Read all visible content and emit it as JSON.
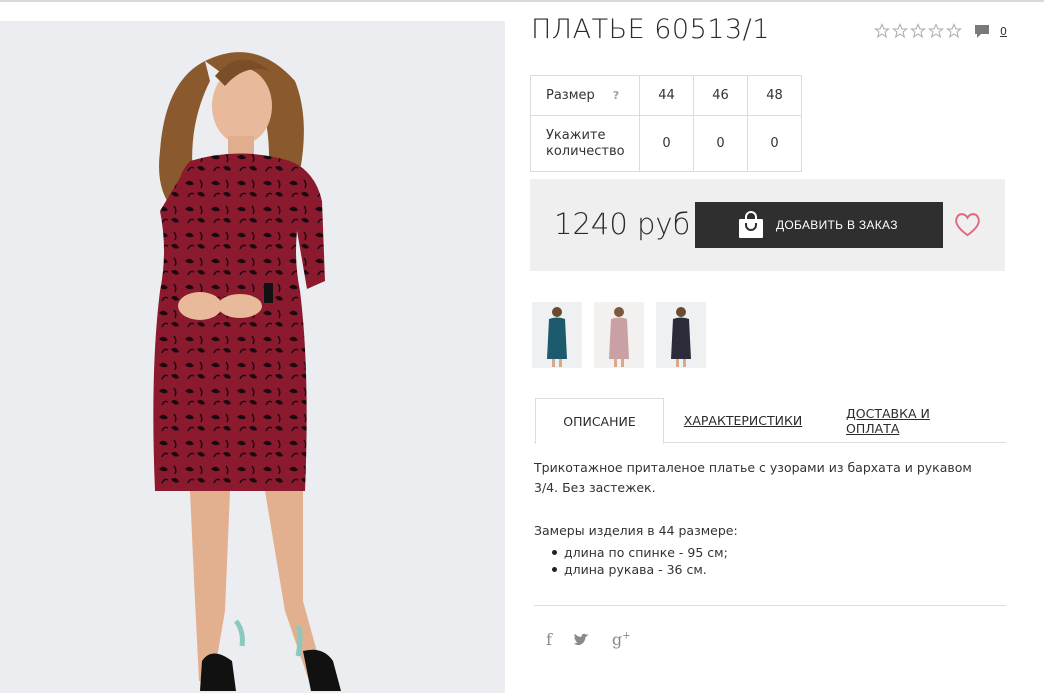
{
  "product": {
    "title": "ПЛАТЬЕ 60513/1",
    "rating_stars": 0,
    "rating_max": 5,
    "comments_count": "0",
    "price": "1240 руб",
    "order_label": "ДОБАВИТЬ В ЗАКАЗ"
  },
  "size_table": {
    "size_label": "Размер",
    "help_mark": "?",
    "qty_label_line1": "Укажите",
    "qty_label_line2": "количество",
    "sizes": [
      "44",
      "46",
      "48"
    ],
    "quantities": [
      "0",
      "0",
      "0"
    ]
  },
  "tabs": [
    {
      "label": "ОПИСАНИЕ",
      "active": true
    },
    {
      "label": "ХАРАКТЕРИСТИКИ",
      "active": false
    },
    {
      "label": "ДОСТАВКА И ОПЛАТА",
      "active": false
    }
  ],
  "description": {
    "text": "Трикотажное приталеное платье с узорами из бархата и рукавом 3/4. Без застежек.",
    "measure_title": "Замеры изделия в 44 размере:",
    "measures": [
      "длина по спинке - 95 см;",
      "длина рукава - 36 см."
    ]
  },
  "thumbnails": [
    {
      "name": "thumb-teal-dress",
      "color": "#1d5a6e"
    },
    {
      "name": "thumb-pink-dress",
      "color": "#c9a1a4"
    },
    {
      "name": "thumb-navy-dress",
      "color": "#2a2c3a"
    }
  ],
  "social": {
    "facebook": "f",
    "twitter": "t",
    "gplus": "g",
    "gplus_sup": "+"
  },
  "colors": {
    "dress": "#8b1a2e",
    "button_bg": "#2f2f2f",
    "heart": "#e06a7a",
    "panel_bg": "#efefef"
  }
}
